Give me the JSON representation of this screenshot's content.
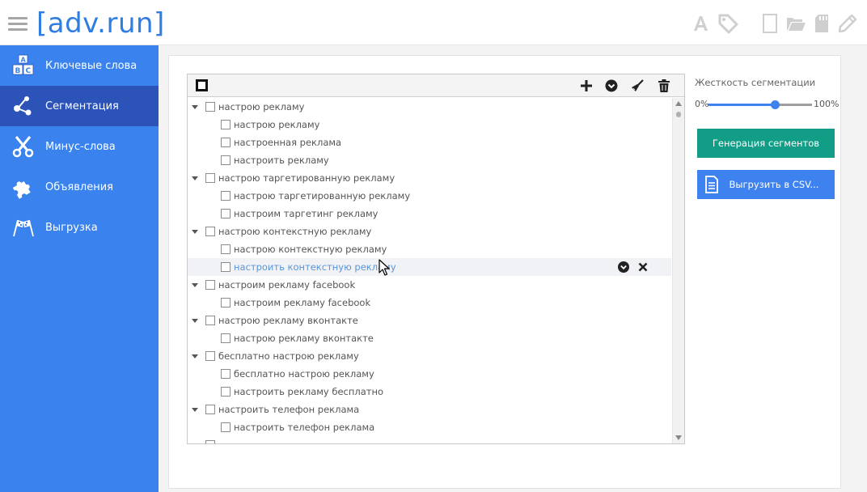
{
  "header": {
    "logo": "[adv.run]",
    "icons": [
      "font-icon",
      "tag-icon",
      "new-file-icon",
      "folder-open-icon",
      "sd-card-icon",
      "pencil-icon"
    ]
  },
  "sidebar": {
    "items": [
      {
        "label": "Ключевые слова",
        "icon": "abc-blocks-icon",
        "active": false
      },
      {
        "label": "Сегментация",
        "icon": "share-nodes-icon",
        "active": true
      },
      {
        "label": "Минус-слова",
        "icon": "scissors-icon",
        "active": false
      },
      {
        "label": "Объявления",
        "icon": "puzzle-icon",
        "active": false
      },
      {
        "label": "Выгрузка",
        "icon": "flags-icon",
        "active": false
      }
    ]
  },
  "tree": {
    "toolbar_icons": [
      "plus-icon",
      "chevron-circle-down-icon",
      "broom-icon",
      "trash-icon"
    ],
    "rows": [
      {
        "level": 0,
        "text": "настрою рекламу"
      },
      {
        "level": 1,
        "text": "настрою рекламу"
      },
      {
        "level": 1,
        "text": "настроенная реклама"
      },
      {
        "level": 1,
        "text": "настроить рекламу"
      },
      {
        "level": 0,
        "text": "настрою таргетированную рекламу"
      },
      {
        "level": 1,
        "text": "настрою таргетированную рекламу"
      },
      {
        "level": 1,
        "text": "настроим таргетинг рекламу"
      },
      {
        "level": 0,
        "text": "настрою контекстную рекламу"
      },
      {
        "level": 1,
        "text": "настрою контекстную рекламу"
      },
      {
        "level": 1,
        "text": "настроить контекстную рекламу",
        "highlighted": true
      },
      {
        "level": 0,
        "text": "настроим рекламу facebook"
      },
      {
        "level": 1,
        "text": "настроим рекламу facebook"
      },
      {
        "level": 0,
        "text": "настрою рекламу вконтакте"
      },
      {
        "level": 1,
        "text": "настрою рекламу вконтакте"
      },
      {
        "level": 0,
        "text": "бесплатно настрою рекламу"
      },
      {
        "level": 1,
        "text": "бесплатно настрою рекламу"
      },
      {
        "level": 1,
        "text": "настроить рекламу бесплатно"
      },
      {
        "level": 0,
        "text": "настроить телефон реклама"
      },
      {
        "level": 1,
        "text": "настроить телефон реклама"
      },
      {
        "level": 0,
        "text": ""
      }
    ]
  },
  "controls": {
    "segmentation_label": "Жесткость сегментации",
    "slider_min": "0%",
    "slider_max": "100%",
    "slider_value": 0.64,
    "generate_button": "Генерация сегментов",
    "export_button": "Выгрузить в CSV..."
  },
  "colors": {
    "brand": "#2f7de1",
    "sidebar": "#3a83ef",
    "sidebar_active": "#2b53b8",
    "generate": "#129d86",
    "export": "#3d82ee"
  }
}
